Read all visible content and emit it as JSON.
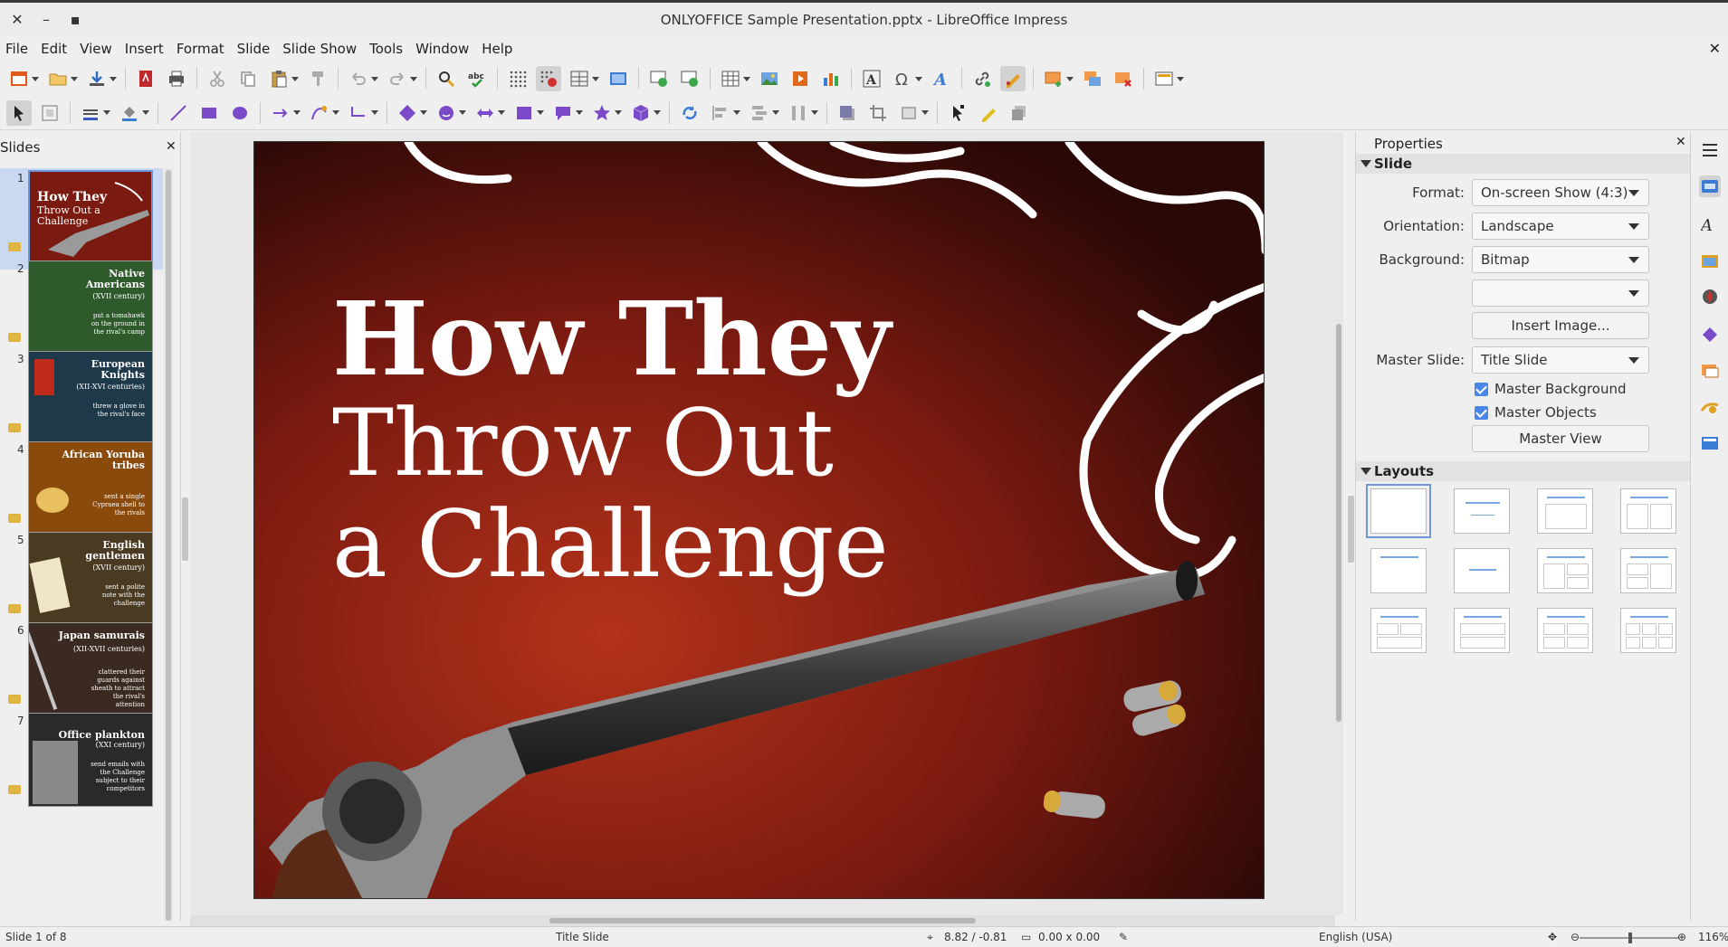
{
  "window": {
    "title": "ONLYOFFICE Sample Presentation.pptx - LibreOffice Impress",
    "close": "✕",
    "minimize": "–",
    "maximize": "▪"
  },
  "menu": [
    "File",
    "Edit",
    "View",
    "Insert",
    "Format",
    "Slide",
    "Slide Show",
    "Tools",
    "Window",
    "Help"
  ],
  "slides_pane": {
    "title": "Slides",
    "close": "✕",
    "thumbnails": [
      {
        "number": "1",
        "title": "How They",
        "subtitle": "Throw Out a Challenge",
        "bg": "#7a1a10"
      },
      {
        "number": "2",
        "title": "Native Americans",
        "subtitle": "(XVII century)",
        "note": "put a tomahawk on the ground in the rival's camp",
        "bg": "#2f5a2c"
      },
      {
        "number": "3",
        "title": "European Knights",
        "subtitle": "(XII-XVI centuries)",
        "note": "threw a glove in the rival's face",
        "bg": "#1e3a4a"
      },
      {
        "number": "4",
        "title": "African Yoruba tribes",
        "subtitle": "",
        "note": "sent a single Cyprаea shell to the rivals",
        "bg": "#8a4a0c"
      },
      {
        "number": "5",
        "title": "English gentlemen",
        "subtitle": "(XVII century)",
        "note": "sent a polite note with the challenge",
        "bg": "#4a3a22"
      },
      {
        "number": "6",
        "title": "Japan samurais",
        "subtitle": "(XII-XVII centuries)",
        "note": "clattered their guards against sheath to attract the rival's attention",
        "bg": "#3a2a22"
      },
      {
        "number": "7",
        "title": "Office plankton",
        "subtitle": "(XXI century)",
        "note": "send emails with the Challenge subject to their competitors",
        "bg": "#2a2a2a"
      }
    ]
  },
  "slide": {
    "title_line1": "How They",
    "title_line2": "Throw Out",
    "title_line3": "a Challenge"
  },
  "properties": {
    "header": "Properties",
    "close": "✕",
    "slide_section": "Slide",
    "format_label": "Format:",
    "format_value": "On-screen Show (4:3)",
    "orientation_label": "Orientation:",
    "orientation_value": "Landscape",
    "background_label": "Background:",
    "background_value": "Bitmap",
    "background_sub_value": "",
    "insert_image": "Insert Image...",
    "master_slide_label": "Master Slide:",
    "master_slide_value": "Title Slide",
    "master_background": "Master Background",
    "master_objects": "Master Objects",
    "master_view": "Master View",
    "layouts_section": "Layouts"
  },
  "status": {
    "slide_counter": "Slide 1 of 8",
    "layout_name": "Title Slide",
    "position": "8.82 / -0.81",
    "size": "0.00 x 0.00",
    "language": "English (USA)",
    "zoom": "116%"
  }
}
